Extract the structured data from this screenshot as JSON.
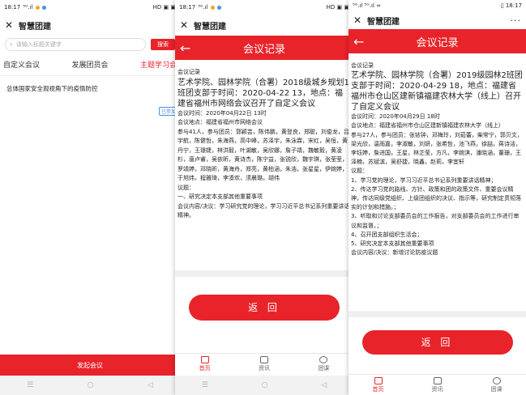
{
  "screen1": {
    "status_time": "18:17",
    "status_signal": "⁵ᴳ.ıl",
    "status_right": "HD ▣ ▣",
    "app_title": "智慧团建",
    "search_placeholder": "请输入标题关键字",
    "search_button": "搜索",
    "tabs": [
      "自定义会议",
      "发展团员会",
      "主题学习会"
    ],
    "list_item": "总体国家安全观视角下的疫情防控",
    "badge": "已参加",
    "launch_button": "发起会议",
    "nav": [
      "☰",
      "○",
      "◁"
    ]
  },
  "screen2": {
    "status_time": "18:17",
    "status_signal": "⁵ᴳ.ıl",
    "status_right": "HD ▣ ▣",
    "app_title": "智慧团建",
    "header_title": "会议记录",
    "section_label": "会议记录",
    "headline": "艺术学院、园林学院（合署）2018级城乡规划1班团支部于时间：2020-04-22 13，地点：福建省福州市网络会议召开了自定义会议",
    "meeting_time": "会议时间：2020年04月22日 13时",
    "meeting_place": "会议地点：福建省福州市网络会议",
    "attendees": "参与41人，参与团员：郭颖芸，陈伟鹏，黄登良，郑聪，刘俊龙，吕宇航，陈健哲，朱海燕，高中峰，苏泽宇，朱泳霖，宋红，吴恒，黄丹宁，王璟婕，林洪毅，叶湖敏，吴欣娜，詹子靖，魏敏毅，黄凌杉，唐卢睿，吴依昕，黄诗杰，陈宁益，张锐欣，魏宇琪，张莹莹，罗靖婷，邓晓昕，黄海舟，郑亮，黄柏涵，朱浩，张星星，伊婉婷，于旭炜，程雅琦，李湊欢，须晨璐，胡伟",
    "topics_label": "议题：",
    "topic1": "一、研究决定本支部其他重要事项",
    "content": "会议内容/决议：学习研究党的理论，学习习近平总书记系列重要讲话精神。",
    "return_button": "返 回",
    "tab_labels": [
      "首页",
      "资讯",
      "团课"
    ],
    "nav": [
      "☰",
      "○",
      "◁"
    ]
  },
  "screen3": {
    "status_left": "⁵ᴳ.ıl ⁵ᴳ.ıl ≈",
    "status_right": "▯ 18:17",
    "app_title": "智慧团建",
    "header_title": "会议记录",
    "section_label": "会议记录",
    "headline": "艺术学院、园林学院（合署）2019级园林2班团支部于时间：2020-04-29 18，地点：福建省福州市仓山区建新镇福建农林大学（线上）召开了自定义会议",
    "meeting_time": "会议时间：2020年04月29日 18时",
    "meeting_place": "会议地点：福建省福州市仓山区建新镇福建农林大学（线上）",
    "attendees": "参与27人，参与团员：张铱钟，邓梅玲，刘茹蕾，柴常宁，郭贝文，梁光欣，温雨嘉，李淑敏，刘妍，张希哲，池飞燕，徐喆，蒋诗洁，李钰婷，詹进国，王星，林芷莹，方凡，李婉淇，潘晓涵，董珊，王泽楠，苏斌滨，吴舒捷，晓鑫，赵莉，李宜轩",
    "topics_label": "议题：",
    "topics": [
      "1、学习党的理论，学习习近平总书记系列重要讲话精神；",
      "2、传达学习党的路线、方针、政策和团的政策文件、重要会议精神，传达同级党组织、上级团组织的决议、指示等，研究制定贯彻落实的计划和措施。；",
      "3、听取和讨论支部委员会的工作报告，对支部委员会的工作进行审议和监督。；",
      "4、召开团支部组织生活会；",
      "5、研究决定本支部其他重要事项"
    ],
    "content": "会议内容/决议：新增讨论防疫议题",
    "return_button": "返 回",
    "tab_labels": [
      "首页",
      "资讯",
      "团课"
    ],
    "nav": [
      "☰",
      "○",
      "◁"
    ]
  },
  "colors": {
    "accent": "#e8232a",
    "link": "#4a90e2"
  }
}
